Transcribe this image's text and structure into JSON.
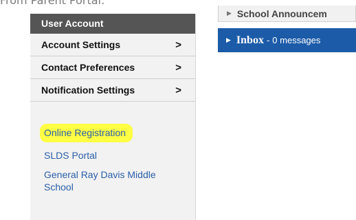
{
  "page": {
    "top_fragment": "From Parent Portal:"
  },
  "sidebar": {
    "header": "User Account",
    "menu": [
      {
        "label": "Account Settings",
        "chevron": ">"
      },
      {
        "label": "Contact Preferences",
        "chevron": ">"
      },
      {
        "label": "Notification Settings",
        "chevron": ">"
      }
    ],
    "links": [
      {
        "label": "Online Registration",
        "highlighted": true
      },
      {
        "label": "SLDS Portal"
      },
      {
        "label": "General Ray Davis Middle School"
      }
    ]
  },
  "panels": {
    "announcements": {
      "label": "School Announcem",
      "icon": "triangle-right-icon"
    },
    "inbox": {
      "title": "Inbox",
      "separator": "-",
      "count_text": "0 messages",
      "icon": "triangle-right-icon"
    }
  },
  "colors": {
    "sidebar_header_bg": "#555555",
    "sidebar_bg": "#f2f2f2",
    "link": "#2a5ea8",
    "highlight": "#ffff44",
    "inbox_bg": "#1c5ba8"
  }
}
